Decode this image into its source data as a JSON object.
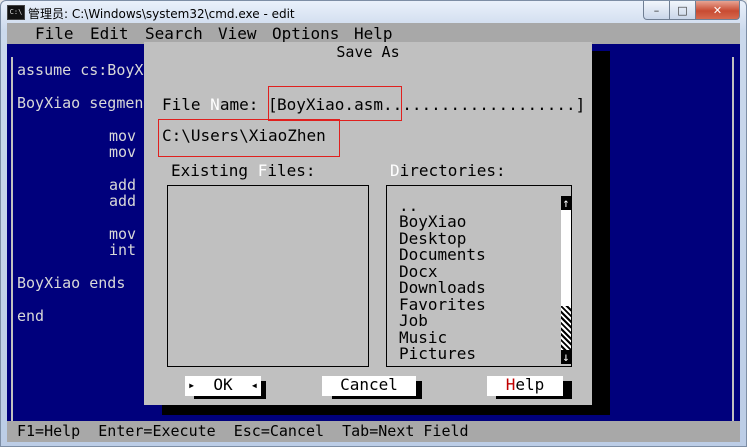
{
  "window": {
    "title": "管理员: C:\\Windows\\system32\\cmd.exe - edit",
    "icon_label": "C:\\",
    "controls": {
      "minimize": "–",
      "maximize": "□",
      "close": "✕"
    }
  },
  "menu": {
    "items": [
      {
        "label": "File"
      },
      {
        "label": "Edit"
      },
      {
        "label": "Search"
      },
      {
        "label": "View"
      },
      {
        "label": "Options"
      },
      {
        "label": "Help"
      }
    ]
  },
  "editor": {
    "lines": [
      "assume cs:BoyX",
      "BoyXiao segmen",
      "mov",
      "mov",
      "add",
      "add",
      "mov",
      "int",
      "BoyXiao ends",
      "end"
    ]
  },
  "dialog": {
    "title": "Save As",
    "file_name_label_pre": "File ",
    "file_name_label_hot": "N",
    "file_name_label_post": "ame: [",
    "file_name_value": "BoyXiao.asm....................]",
    "current_path": "C:\\Users\\XiaoZhen",
    "existing_files_pre": "Existing ",
    "existing_files_hot": "F",
    "existing_files_post": "iles:",
    "directories_hot": "D",
    "directories_post": "irectories:",
    "directories": [
      "..",
      "BoyXiao",
      "Desktop",
      "Documents",
      "Docx",
      "Downloads",
      "Favorites",
      "Job",
      "Music",
      "Pictures"
    ],
    "scroll_up": "↑",
    "scroll_down": "↓",
    "buttons": {
      "ok": "OK",
      "cancel": "Cancel",
      "help_hot": "H",
      "help_post": "elp",
      "ok_marker_left": "▸",
      "ok_marker_right": "◂"
    }
  },
  "status_bar": {
    "text": "F1=Help  Enter=Execute  Esc=Cancel  Tab=Next Field"
  },
  "colors": {
    "console_bg": "#00007C",
    "menu_bg": "#A8A8A8",
    "dialog_bg": "#C0C0C0",
    "highlight_box": "#E0201E"
  }
}
